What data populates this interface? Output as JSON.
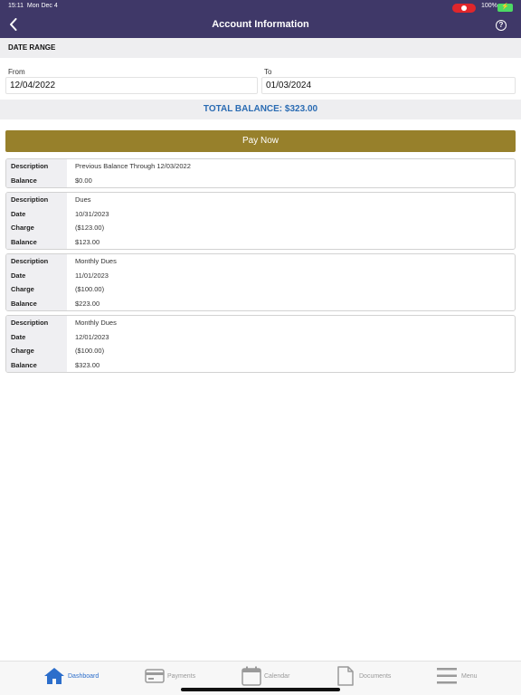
{
  "status": {
    "time": "15:11",
    "date": "Mon Dec 4",
    "battery": "100%"
  },
  "nav": {
    "title": "Account Information",
    "back_icon": "chevron-left-icon",
    "help_icon": "help-circle-icon",
    "help_glyph": "?"
  },
  "date_range": {
    "title": "DATE RANGE",
    "from_label": "From",
    "from_value": "12/04/2022",
    "to_label": "To",
    "to_value": "01/03/2024"
  },
  "balance": {
    "text": "TOTAL BALANCE: $323.00",
    "color": "#2b6cb3"
  },
  "pay_button": {
    "label": "Pay Now",
    "color": "#97802b"
  },
  "transactions": [
    {
      "rows": [
        {
          "label": "Description",
          "value": "Previous Balance Through 12/03/2022"
        },
        {
          "label": "Balance",
          "value": "$0.00"
        }
      ]
    },
    {
      "rows": [
        {
          "label": "Description",
          "value": "Dues"
        },
        {
          "label": "Date",
          "value": "10/31/2023"
        },
        {
          "label": "Charge",
          "value": "($123.00)"
        },
        {
          "label": "Balance",
          "value": "$123.00"
        }
      ]
    },
    {
      "rows": [
        {
          "label": "Description",
          "value": "Monthly Dues"
        },
        {
          "label": "Date",
          "value": "11/01/2023"
        },
        {
          "label": "Charge",
          "value": "($100.00)"
        },
        {
          "label": "Balance",
          "value": "$223.00"
        }
      ]
    },
    {
      "rows": [
        {
          "label": "Description",
          "value": "Monthly Dues"
        },
        {
          "label": "Date",
          "value": "12/01/2023"
        },
        {
          "label": "Charge",
          "value": "($100.00)"
        },
        {
          "label": "Balance",
          "value": "$323.00"
        }
      ]
    }
  ],
  "tabs": [
    {
      "label": "Dashboard",
      "icon": "home-icon",
      "active": true
    },
    {
      "label": "Payments",
      "icon": "credit-card-icon",
      "active": false
    },
    {
      "label": "Calendar",
      "icon": "calendar-icon",
      "active": false
    },
    {
      "label": "Documents",
      "icon": "document-icon",
      "active": false
    },
    {
      "label": "Menu",
      "icon": "menu-icon",
      "active": false
    }
  ],
  "colors": {
    "header": "#3f3868",
    "active_tab": "#2c6ecb",
    "inactive_tab": "#9a9a9a"
  }
}
